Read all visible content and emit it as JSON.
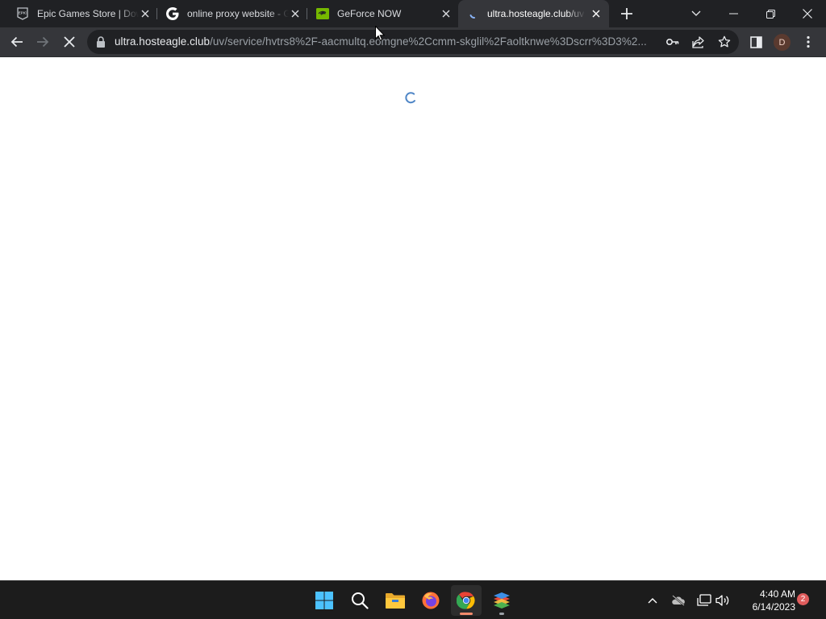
{
  "tabs": [
    {
      "title": "Epic Games Store | Dow",
      "favicon": "epic-games-icon",
      "active": false
    },
    {
      "title": "online proxy website - G",
      "favicon": "google-icon",
      "active": false
    },
    {
      "title": "GeForce NOW",
      "favicon": "nvidia-icon",
      "active": false
    },
    {
      "title": "ultra.hosteagle.club/uv",
      "favicon": "loading-spinner-icon",
      "active": true
    }
  ],
  "toolbar": {
    "url_host": "ultra.hosteagle.club",
    "url_path": "/uv/service/hvtrs8%2F-aacmultq.eomgne%2Ccmm-skglil%2Faoltknwe%3Dscrr%3D3%2..."
  },
  "profile": {
    "initial": "D"
  },
  "taskbar": {
    "apps": [
      "windows-start-icon",
      "search-icon",
      "file-explorer-icon",
      "firefox-icon",
      "chrome-icon",
      "bluestacks-icon"
    ],
    "time": "4:40 AM",
    "date": "6/14/2023",
    "notification_count": "2"
  },
  "colors": {
    "tabstrip_bg": "#202124",
    "toolbar_bg": "#35363a",
    "omnibox_bg": "#202124",
    "taskbar_bg": "#1c1c1c",
    "spinner": "#4f86c6",
    "badge": "#e05d5d"
  }
}
